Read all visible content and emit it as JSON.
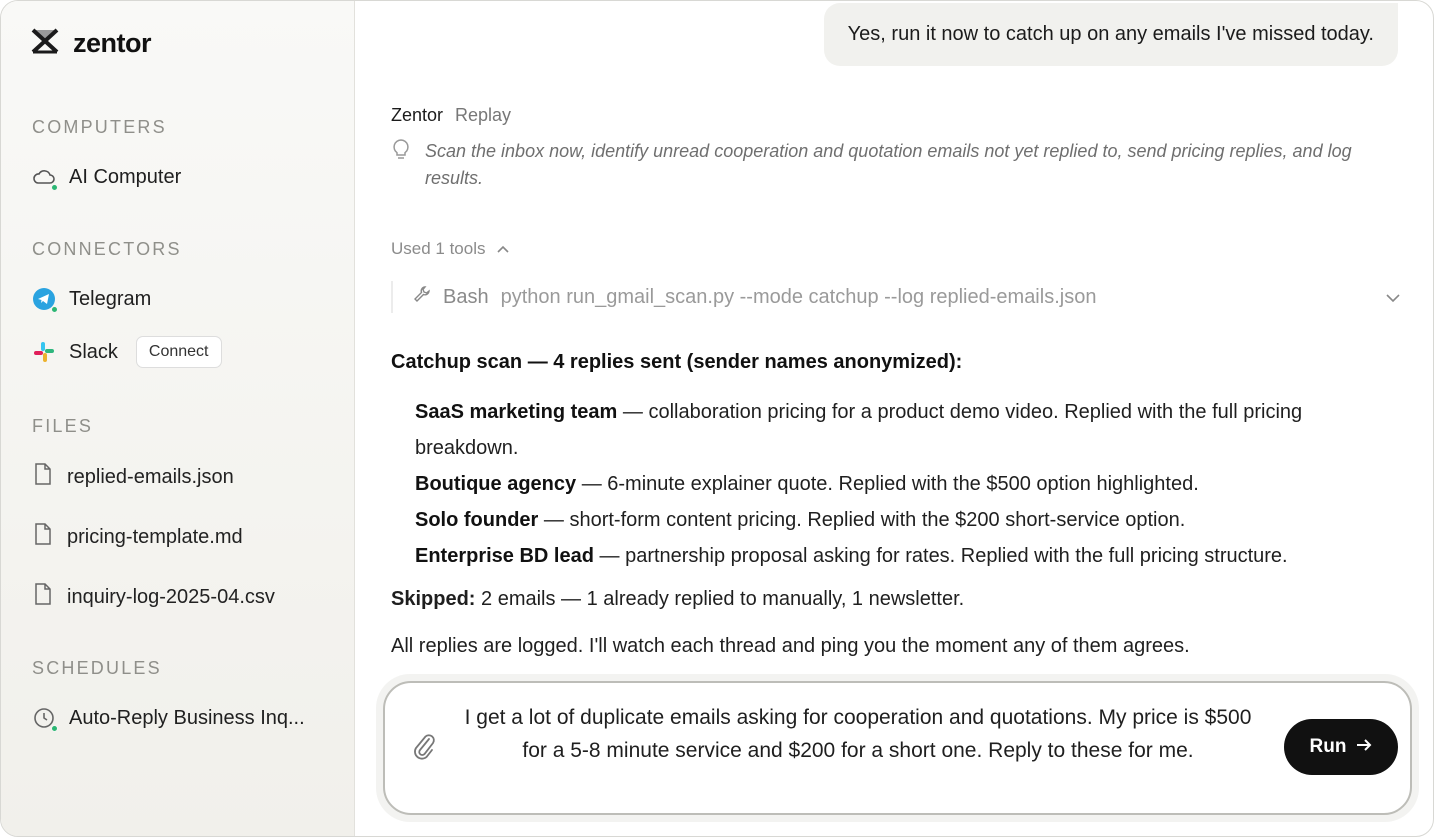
{
  "brand": {
    "name": "zentor"
  },
  "sidebar": {
    "sections": {
      "computers": "COMPUTERS",
      "connectors": "CONNECTORS",
      "files": "FILES",
      "schedules": "SCHEDULES"
    },
    "computers": [
      {
        "label": "AI Computer",
        "icon": "cloud-icon"
      }
    ],
    "connectors": [
      {
        "label": "Telegram",
        "icon": "telegram-icon"
      },
      {
        "label": "Slack",
        "icon": "slack-icon",
        "action": "Connect"
      }
    ],
    "files": [
      {
        "label": "replied-emails.json",
        "icon": "file-icon"
      },
      {
        "label": "pricing-template.md",
        "icon": "file-icon"
      },
      {
        "label": "inquiry-log-2025-04.csv",
        "icon": "file-icon"
      }
    ],
    "schedules": [
      {
        "label": "Auto-Reply Business Inq...",
        "icon": "clock-icon"
      }
    ]
  },
  "chat": {
    "user_message": "Yes, run it now to catch up on any emails I've missed today.",
    "assistant_name": "Zentor",
    "assistant_action": "Replay",
    "thought": "Scan the inbox now, identify unread cooperation and quotation emails not yet replied to, send pricing replies, and log results.",
    "tools_label": "Used 1 tools",
    "tool": {
      "name": "Bash",
      "command": "python run_gmail_scan.py --mode catchup --log replied-emails.json"
    },
    "heading": "Catchup scan — 4 replies sent (sender names anonymized):",
    "replies": [
      {
        "sender": "SaaS marketing team",
        "text": " — collaboration pricing for a product demo video. Replied with the full pricing breakdown."
      },
      {
        "sender": "Boutique agency",
        "text": " — 6-minute explainer quote. Replied with the $500 option highlighted."
      },
      {
        "sender": "Solo founder",
        "text": " — short-form content pricing. Replied with the $200 short-service option."
      },
      {
        "sender": "Enterprise BD lead",
        "text": " — partnership proposal asking for rates. Replied with the full pricing structure."
      }
    ],
    "skipped_label": "Skipped:",
    "skipped_text": " 2 emails — 1 already replied to manually, 1 newsletter.",
    "closing": "All replies are logged. I'll watch each thread and ping you the moment any of them agrees."
  },
  "composer": {
    "text": "I get a lot of duplicate emails asking for cooperation and quotations. My price is $500 for a 5-8 minute service and $200 for a short one. Reply to these for me.",
    "run_label": "Run"
  },
  "colors": {
    "accent": "#111111",
    "online": "#2bb673",
    "telegram": "#2aa3e0"
  }
}
